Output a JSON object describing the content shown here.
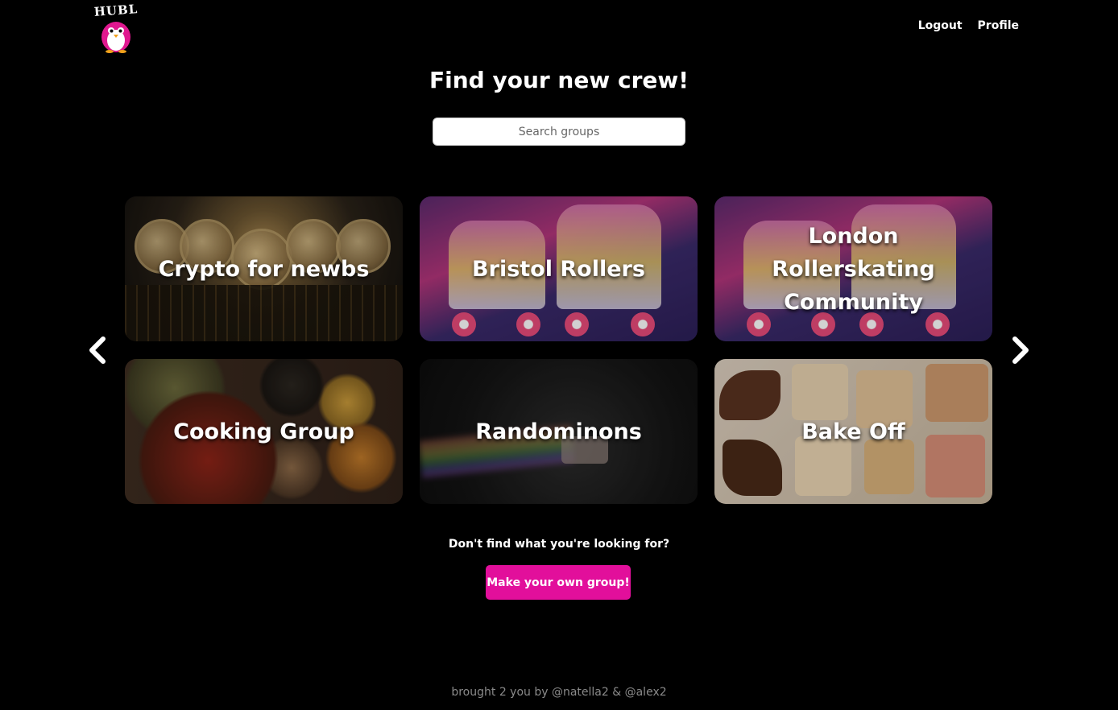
{
  "header": {
    "logo_text": "HUBL",
    "nav": [
      {
        "label": "Logout"
      },
      {
        "label": "Profile"
      }
    ]
  },
  "main": {
    "title": "Find your new crew!",
    "search": {
      "placeholder": "Search groups",
      "value": ""
    }
  },
  "carousel": {
    "prev_icon": "chevron-left-icon",
    "next_icon": "chevron-right-icon",
    "groups": [
      {
        "name": "Crypto for newbs",
        "image": "bitcoin coins"
      },
      {
        "name": "Bristol Rollers",
        "image": "roller skates"
      },
      {
        "name": "London Rollerskating Community",
        "image": "roller skates"
      },
      {
        "name": "Cooking Group",
        "image": "spices"
      },
      {
        "name": "Randominons",
        "image": "nyan cat"
      },
      {
        "name": "Bake Off",
        "image": "cookies"
      }
    ]
  },
  "cta": {
    "text": "Don't find what you're looking for?",
    "button_label": "Make your own group!"
  },
  "footer": {
    "text": "brought 2 you by @natella2 & @alex2"
  },
  "colors": {
    "background": "#000000",
    "accent": "#e20f9b",
    "text": "#ffffff",
    "footer_text": "#8a8a8a"
  }
}
